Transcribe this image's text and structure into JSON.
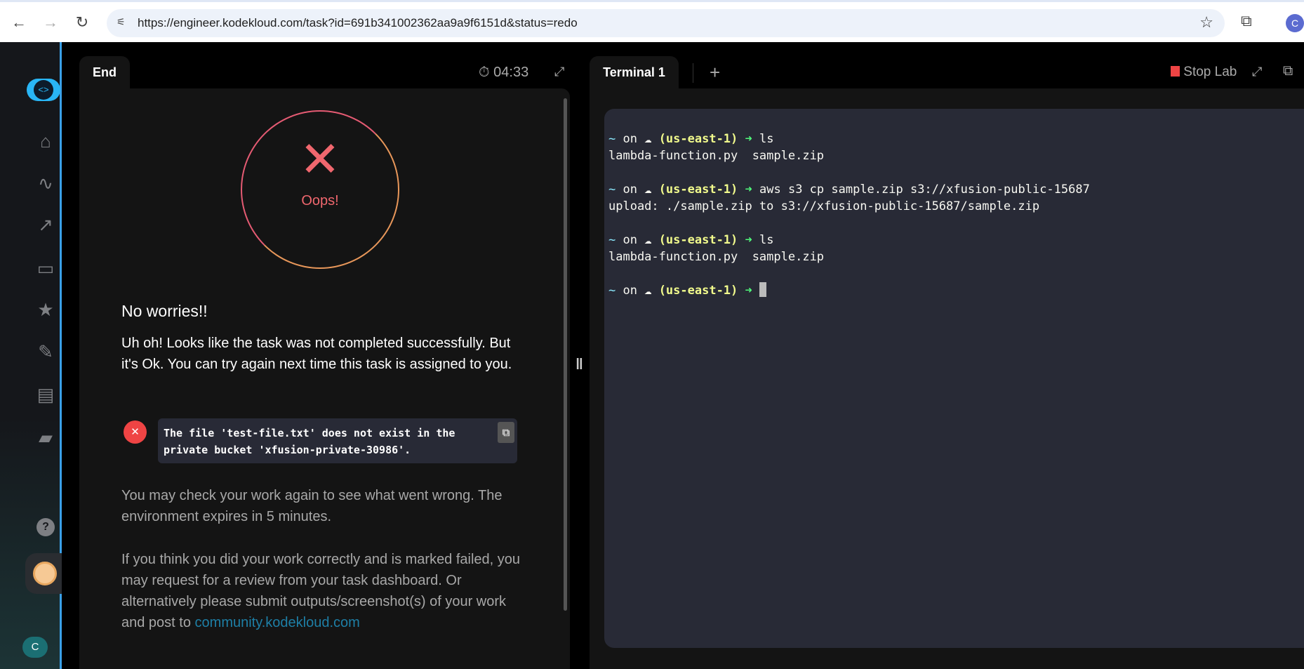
{
  "browser": {
    "url": "https://engineer.kodekloud.com/task?id=691b341002362aa9a9f6151d&status=redo",
    "profile_initial": "C"
  },
  "left_panel": {
    "tab": "End",
    "timer": "04:33",
    "status": "Oops!",
    "heading": "No worries!!",
    "message": "Uh oh! Looks like the task was not completed successfully. But it's Ok. You can try again next time this task is assigned to you.",
    "error": "The file 'test-file.txt' does not exist in the private bucket 'xfusion-private-30986'.",
    "info": "You may check your work again to see what went wrong. The environment expires in 5 minutes.",
    "review": "If you think you did your work correctly and is marked failed, you may request for a review from your task dashboard. Or alternatively please submit outputs/screenshot(s) of your work and post to ",
    "link": "community.kodekloud.com"
  },
  "sidebar": {
    "user_initial": "C"
  },
  "right_panel": {
    "tab": "Terminal 1",
    "add": "+",
    "stop_lab": "Stop Lab"
  },
  "terminal": {
    "prompt": {
      "tilde": "~",
      "on": " on ",
      "region": "(us-east-1)",
      "arrow": "➜"
    },
    "lines": [
      {
        "cmd": "ls"
      },
      {
        "out": "lambda-function.py  sample.zip"
      },
      {
        "out": ""
      },
      {
        "cmd": "aws s3 cp sample.zip s3://xfusion-public-15687"
      },
      {
        "out": "upload: ./sample.zip to s3://xfusion-public-15687/sample.zip"
      },
      {
        "out": ""
      },
      {
        "cmd": "ls"
      },
      {
        "out": "lambda-function.py  sample.zip"
      },
      {
        "out": ""
      },
      {
        "cmd": ""
      }
    ]
  },
  "colors": {
    "accent": "#3aa0e8",
    "error": "#ef4444",
    "link": "#1e7fa6",
    "stop": "#ef4444"
  }
}
